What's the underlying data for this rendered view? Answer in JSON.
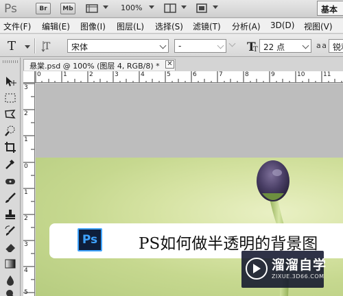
{
  "app": {
    "logo": "Ps",
    "bridge_label": "Br",
    "minibridge_label": "Mb",
    "zoom": "100%",
    "workspace_label": "基本"
  },
  "menu": [
    "文件(F)",
    "编辑(E)",
    "图像(I)",
    "图层(L)",
    "选择(S)",
    "滤镜(T)",
    "分析(A)",
    "3D(D)",
    "视图(V)"
  ],
  "options": {
    "font_family": "宋体",
    "font_style": "-",
    "font_size": "22 点",
    "aa_glyph": "a a",
    "aa_method": "锐利"
  },
  "document": {
    "tab_title": "悬棠.psd @ 100% (图层 4, RGB/8) *",
    "close_glyph": "✕"
  },
  "ruler": {
    "top": [
      "0",
      "1",
      "2",
      "3",
      "4",
      "5",
      "6",
      "7",
      "8",
      "9",
      "10",
      "11"
    ],
    "left": [
      "3",
      "2",
      "1",
      "0",
      "1",
      "2",
      "3",
      "4",
      "5"
    ]
  },
  "canvas": {
    "banner_badge": "Ps",
    "banner_title": "PS如何做半透明的背景图"
  },
  "watermark": {
    "name": "溜溜自学",
    "url": "ZIXUE.3D66.COM"
  },
  "icons": {
    "move": "move-icon",
    "marquee": "rect-marquee-icon",
    "lasso": "lasso-icon",
    "quick_select": "quick-select-icon",
    "crop": "crop-icon",
    "eyedropper": "eyedropper-icon",
    "heal": "healing-brush-icon",
    "brush": "brush-icon",
    "stamp": "clone-stamp-icon",
    "history_brush": "history-brush-icon",
    "eraser": "eraser-icon",
    "gradient": "gradient-icon",
    "dodge": "dodge-icon",
    "zoom_tool": "zoom-icon"
  },
  "colors": {
    "canvas_grey": "#bdbdbd",
    "ps_blue": "#3fa3ff",
    "ps_dark": "#0e1e3a",
    "watermark_bg": "#12162d"
  }
}
